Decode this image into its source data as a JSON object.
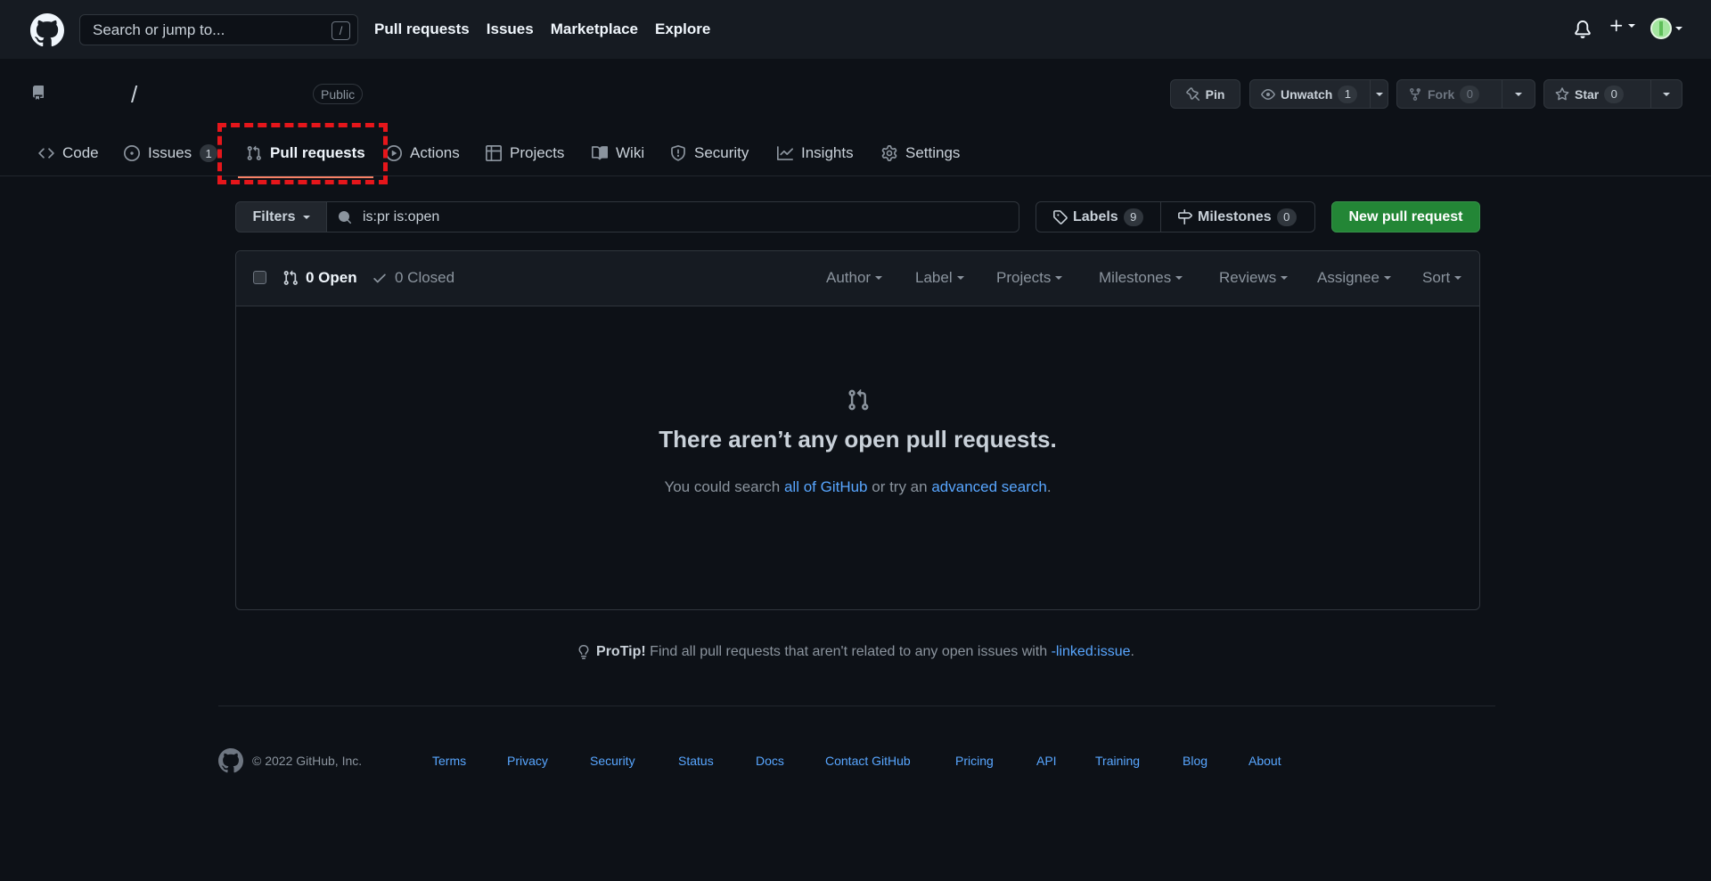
{
  "header": {
    "search_placeholder": "Search or jump to...",
    "search_shortcut": "/",
    "nav": [
      "Pull requests",
      "Issues",
      "Marketplace",
      "Explore"
    ]
  },
  "repo": {
    "separator": "/",
    "visibility": "Public",
    "pin_label": "Pin",
    "unwatch_label": "Unwatch",
    "watch_count": "1",
    "fork_label": "Fork",
    "fork_count": "0",
    "star_label": "Star",
    "star_count": "0"
  },
  "tabs": [
    {
      "label": "Code",
      "icon": "code-icon"
    },
    {
      "label": "Issues",
      "icon": "issue-icon",
      "counter": "1"
    },
    {
      "label": "Pull requests",
      "icon": "pull-request-icon",
      "selected": true
    },
    {
      "label": "Actions",
      "icon": "play-icon"
    },
    {
      "label": "Projects",
      "icon": "table-icon"
    },
    {
      "label": "Wiki",
      "icon": "book-icon"
    },
    {
      "label": "Security",
      "icon": "shield-icon"
    },
    {
      "label": "Insights",
      "icon": "graph-icon"
    },
    {
      "label": "Settings",
      "icon": "gear-icon"
    }
  ],
  "subnav": {
    "filters_label": "Filters",
    "filter_query": "is:pr is:open",
    "labels_label": "Labels",
    "labels_count": "9",
    "milestones_label": "Milestones",
    "milestones_count": "0",
    "new_pr_label": "New pull request"
  },
  "list": {
    "open_label": "0 Open",
    "closed_label": "0 Closed",
    "filters": [
      "Author",
      "Label",
      "Projects",
      "Milestones",
      "Reviews",
      "Assignee",
      "Sort"
    ],
    "empty_title": "There aren’t any open pull requests.",
    "empty_text_1": "You could search ",
    "empty_link_1": "all of GitHub",
    "empty_text_2": " or try an ",
    "empty_link_2": "advanced search",
    "empty_text_3": "."
  },
  "protip": {
    "label": "ProTip!",
    "text": " Find all pull requests that aren't related to any open issues with ",
    "link": "-linked:issue",
    "end": "."
  },
  "footer": {
    "copyright": "© 2022 GitHub, Inc.",
    "links": [
      "Terms",
      "Privacy",
      "Security",
      "Status",
      "Docs",
      "Contact GitHub",
      "Pricing",
      "API",
      "Training",
      "Blog",
      "About"
    ]
  },
  "colors": {
    "background": "#0d1117",
    "header": "#161b22",
    "accent_green": "#238636",
    "link": "#58a6ff",
    "tab_underline": "#f78166",
    "annotation_red": "#e5161b"
  }
}
